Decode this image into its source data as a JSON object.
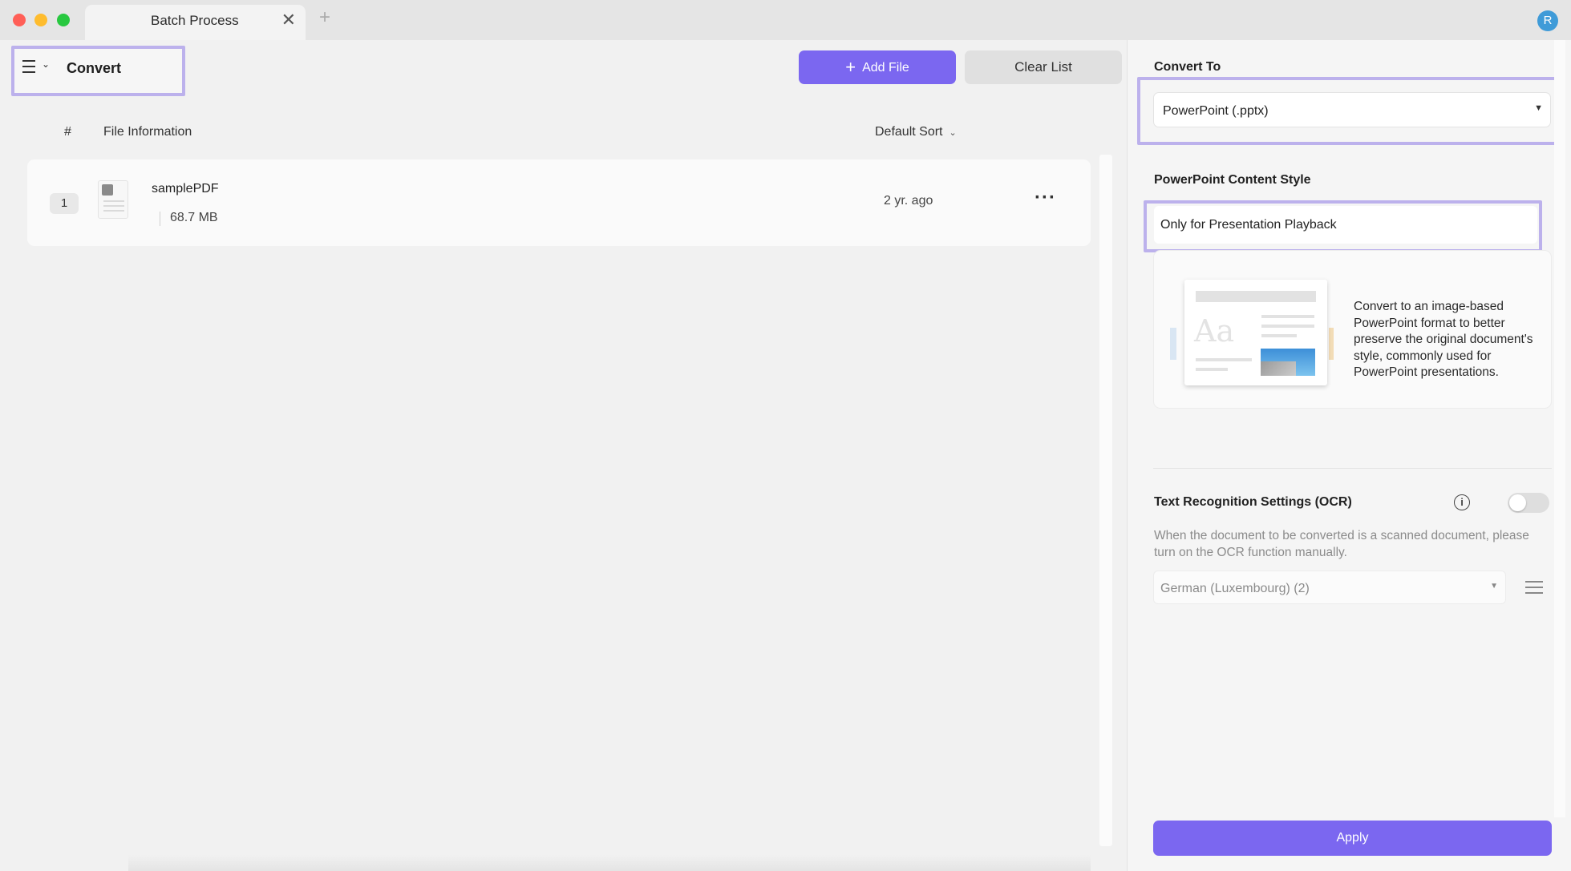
{
  "window": {
    "tab_title": "Batch Process",
    "tab_close": "✕",
    "new_tab": "+",
    "avatar_initial": "R"
  },
  "toolbar": {
    "mode_label": "Convert",
    "add_file_label": "Add File",
    "clear_list_label": "Clear List"
  },
  "file_list": {
    "columns": {
      "index": "#",
      "info": "File Information"
    },
    "sort_label": "Default Sort",
    "files": [
      {
        "index": "1",
        "name": "samplePDF",
        "size": "68.7 MB",
        "modified": "2 yr. ago"
      }
    ]
  },
  "settings": {
    "convert_to_label": "Convert To",
    "convert_to_value": "PowerPoint (.pptx)",
    "content_style_label": "PowerPoint Content Style",
    "content_style_value": "Only for Presentation Playback",
    "style_description": "Convert to an image-based PowerPoint format to better preserve the original document's style, commonly used for PowerPoint presentations.",
    "illustration_glyph": "Aa",
    "ocr_label": "Text Recognition Settings (OCR)",
    "ocr_enabled": false,
    "ocr_description": "When the document to be converted is a scanned document, please turn on the OCR function manually.",
    "ocr_language": "German (Luxembourg) (2)",
    "apply_label": "Apply"
  },
  "colors": {
    "accent": "#7b67f0",
    "highlight_border": "#bcb1ec",
    "traffic_close": "#ff5f57",
    "traffic_minimize": "#febc2e",
    "traffic_maximize": "#28c840",
    "avatar": "#3f9bd8"
  },
  "icons": [
    "close-icon",
    "plus-icon",
    "menu-icon",
    "chevron-down-icon",
    "file-icon",
    "more-icon",
    "info-icon",
    "sliders-icon",
    "dropdown-arrow-icon"
  ]
}
